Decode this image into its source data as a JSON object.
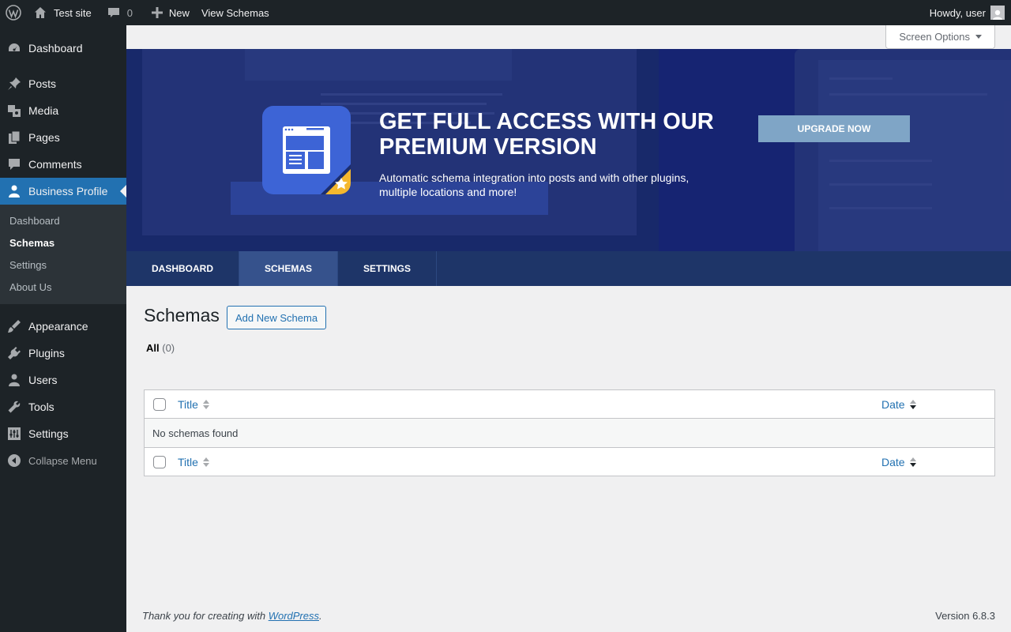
{
  "adminbar": {
    "site_name": "Test site",
    "comments_count": "0",
    "new_label": "New",
    "view_label": "View Schemas",
    "howdy": "Howdy, user"
  },
  "menu": {
    "dashboard": "Dashboard",
    "posts": "Posts",
    "media": "Media",
    "pages": "Pages",
    "comments": "Comments",
    "business_profile": "Business Profile",
    "submenu": [
      "Dashboard",
      "Schemas",
      "Settings",
      "About Us"
    ],
    "appearance": "Appearance",
    "plugins": "Plugins",
    "users": "Users",
    "tools": "Tools",
    "settings": "Settings",
    "collapse": "Collapse Menu"
  },
  "screen_options": "Screen Options",
  "banner": {
    "title": "GET FULL ACCESS WITH OUR PREMIUM VERSION",
    "text": "Automatic schema integration into posts and with other plugins, multiple locations and more!",
    "button": "UPGRADE NOW"
  },
  "tabs": [
    "DASHBOARD",
    "SCHEMAS",
    "SETTINGS"
  ],
  "page": {
    "title": "Schemas",
    "add_new": "Add New Schema",
    "filter_all": "All",
    "filter_count": "(0)"
  },
  "table": {
    "col_title": "Title",
    "col_date": "Date",
    "empty": "No schemas found"
  },
  "footer": {
    "thanks_prefix": "Thank you for creating with",
    "wp_link": "WordPress",
    "thanks_suffix": ".",
    "version": "Version 6.8.3"
  },
  "colors": {
    "admin_dark": "#1d2327",
    "accent": "#2271b1",
    "banner_bg": "#1b2d6e",
    "tabs_bg": "#1e3568"
  }
}
